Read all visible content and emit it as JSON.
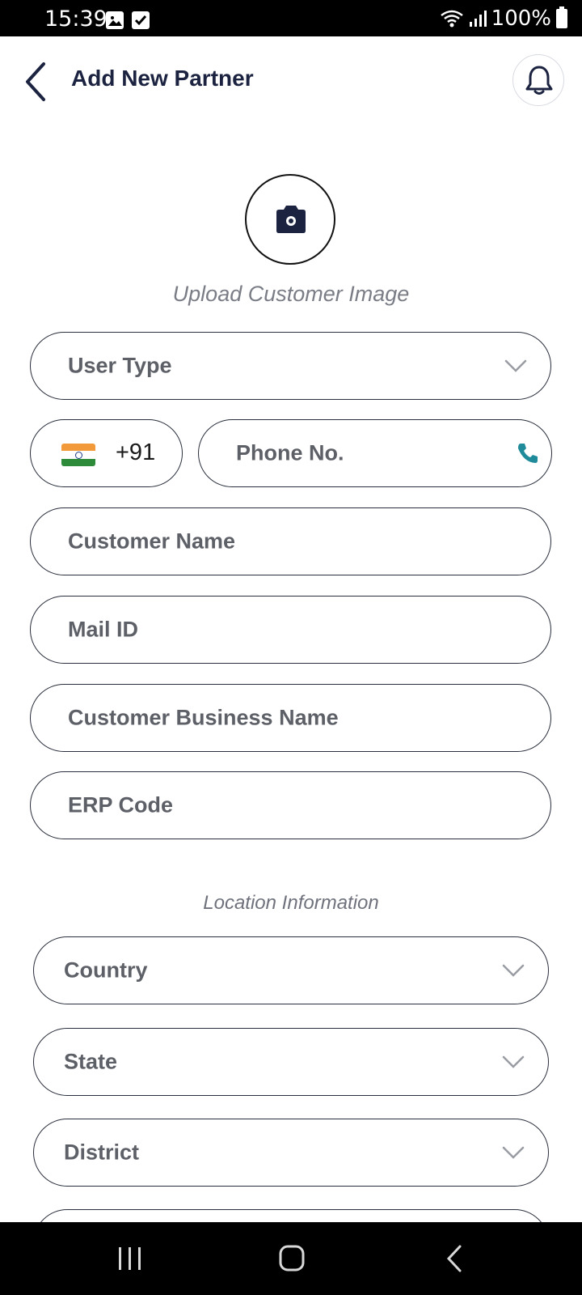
{
  "status_bar": {
    "time": "15:39",
    "battery": "100%"
  },
  "header": {
    "title": "Add New Partner"
  },
  "upload": {
    "label": "Upload Customer Image"
  },
  "form": {
    "user_type_placeholder": "User Type",
    "country_code": "+91",
    "phone_placeholder": "Phone No.",
    "customer_name_placeholder": "Customer Name",
    "mail_placeholder": "Mail ID",
    "business_name_placeholder": "Customer Business Name",
    "erp_placeholder": "ERP Code"
  },
  "location": {
    "section_title": "Location Information",
    "country_placeholder": "Country",
    "state_placeholder": "State",
    "district_placeholder": "District"
  },
  "icons": {
    "back": "chevron-left-icon",
    "bell": "bell-icon",
    "camera": "camera-icon",
    "flag": "india-flag-icon",
    "phone": "phone-icon",
    "dropdown": "chevron-down-icon"
  },
  "colors": {
    "primary": "#1b2340",
    "accent_phone": "#1f8a9a",
    "placeholder": "#5e6068"
  }
}
